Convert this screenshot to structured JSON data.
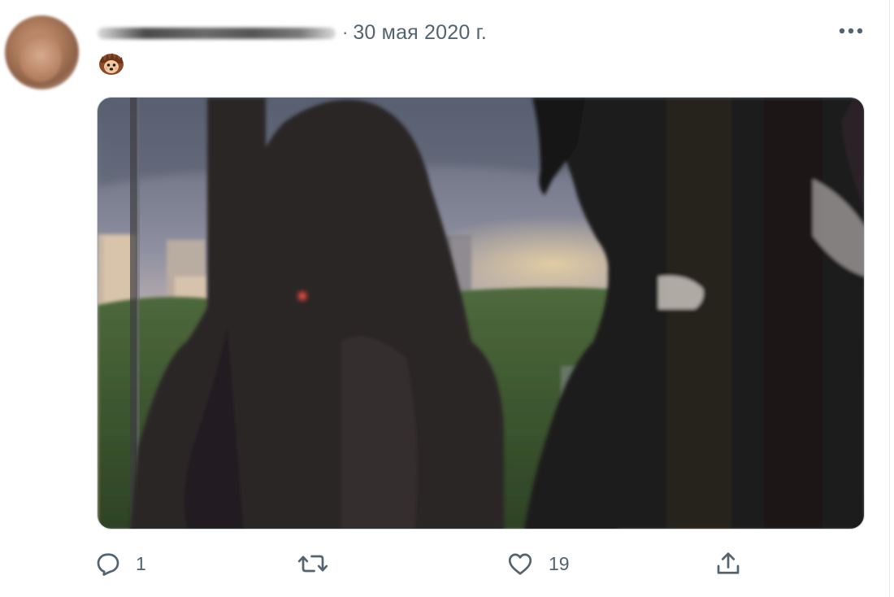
{
  "tweet": {
    "date_separator": "·",
    "date": "30 мая 2020 г.",
    "emoji_icon": "hedgehog-icon",
    "more_icon": "more-horizontal-icon"
  },
  "actions": {
    "reply": {
      "icon": "reply-icon",
      "count": "1"
    },
    "retweet": {
      "icon": "retweet-icon",
      "count": ""
    },
    "like": {
      "icon": "heart-icon",
      "count": "19"
    },
    "share": {
      "icon": "share-icon",
      "count": ""
    }
  },
  "colors": {
    "muted_text": "#536471",
    "border": "#cfd9de",
    "background": "#ffffff"
  }
}
